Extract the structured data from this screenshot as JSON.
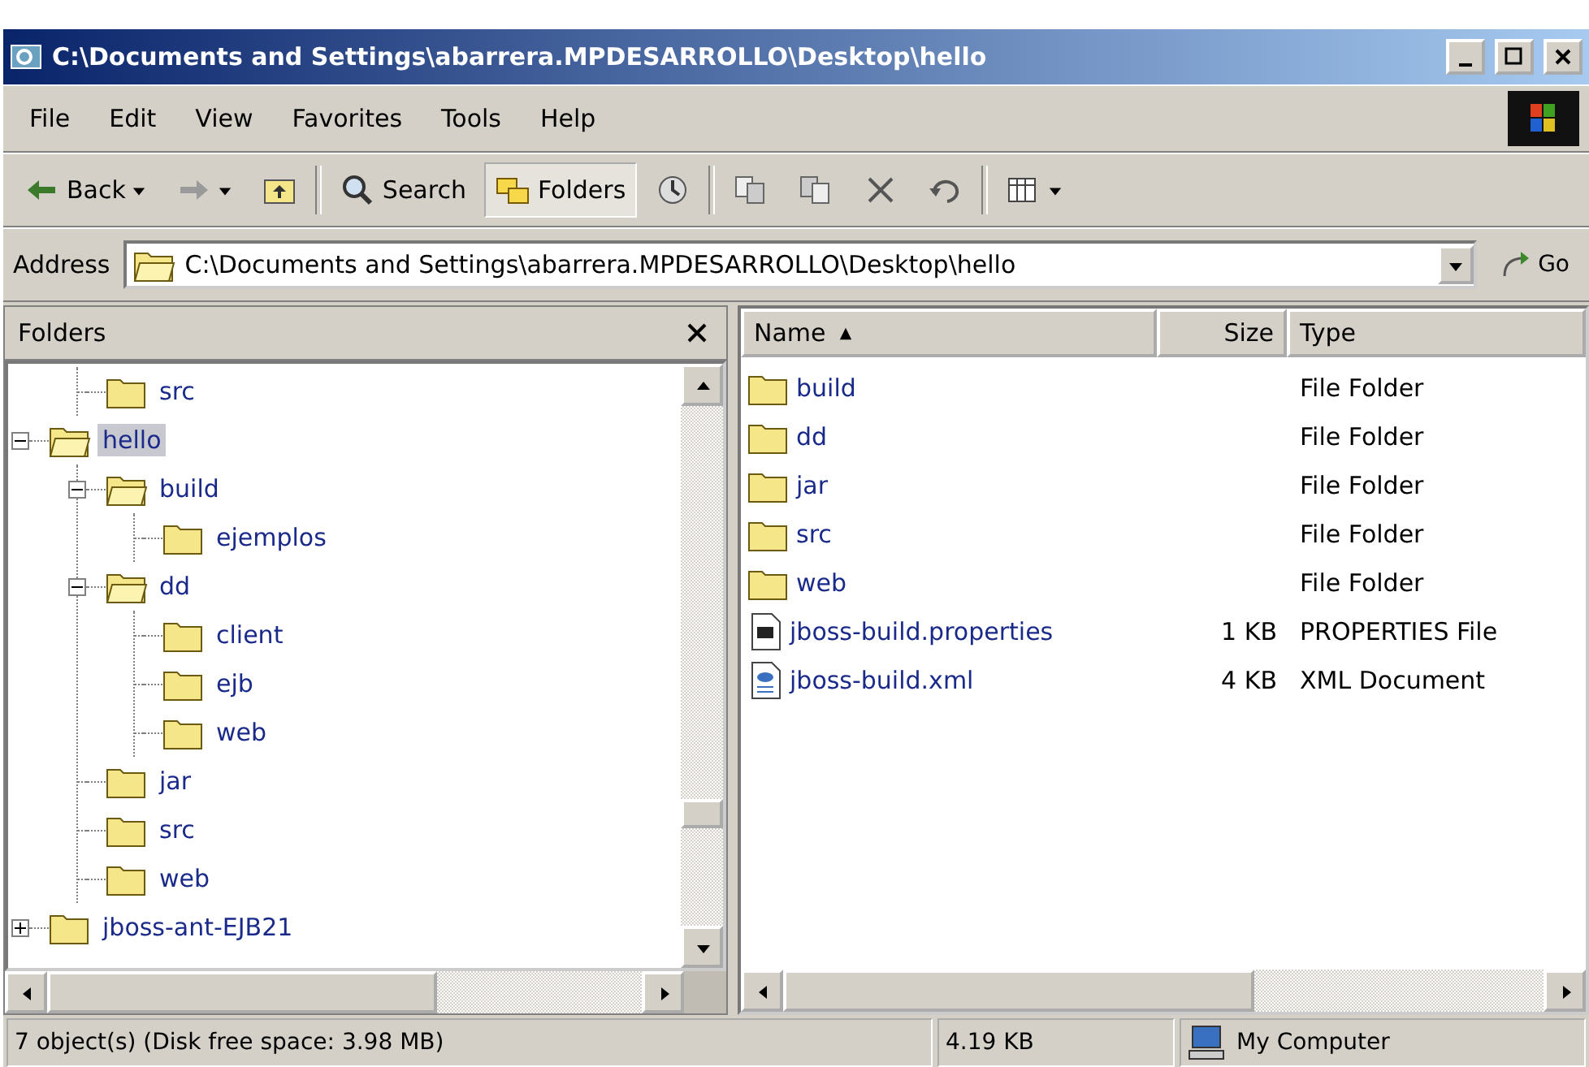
{
  "window": {
    "title": "C:\\Documents and Settings\\abarrera.MPDESARROLLO\\Desktop\\hello"
  },
  "menu": [
    "File",
    "Edit",
    "View",
    "Favorites",
    "Tools",
    "Help"
  ],
  "toolbar": [
    {
      "kind": "back",
      "label": "Back"
    },
    {
      "kind": "forward",
      "disabled": true
    },
    {
      "kind": "up"
    },
    {
      "kind": "sep"
    },
    {
      "kind": "search",
      "label": "Search",
      "selected": false
    },
    {
      "kind": "folders",
      "label": "Folders",
      "selected": true
    },
    {
      "kind": "history"
    },
    {
      "kind": "sep"
    },
    {
      "kind": "moveto"
    },
    {
      "kind": "copyto"
    },
    {
      "kind": "delete"
    },
    {
      "kind": "undo"
    },
    {
      "kind": "sep"
    },
    {
      "kind": "views"
    }
  ],
  "address": {
    "label": "Address",
    "value": "C:\\Documents and Settings\\abarrera.MPDESARROLLO\\Desktop\\hello",
    "go": "Go"
  },
  "folders_pane": {
    "title": "Folders",
    "scrolled_parent_children": [
      {
        "label": "src",
        "selected": false
      }
    ],
    "tree": [
      {
        "label": "hello",
        "selected": true,
        "expanded": true,
        "children": [
          {
            "label": "build",
            "selected": false,
            "expanded": true,
            "children": [
              {
                "label": "ejemplos",
                "selected": false
              }
            ]
          },
          {
            "label": "dd",
            "selected": false,
            "expanded": true,
            "children": [
              {
                "label": "client",
                "selected": false
              },
              {
                "label": "ejb",
                "selected": false
              },
              {
                "label": "web",
                "selected": false
              }
            ]
          },
          {
            "label": "jar",
            "selected": false
          },
          {
            "label": "src",
            "selected": false
          },
          {
            "label": "web",
            "selected": false
          }
        ]
      },
      {
        "label": "jboss-ant-EJB21",
        "selected": false,
        "expanded": false
      }
    ]
  },
  "file_list": {
    "columns": [
      {
        "label": "Name",
        "sorted": true
      },
      {
        "label": "Size",
        "sorted": false
      },
      {
        "label": "Type",
        "sorted": false
      }
    ],
    "rows": [
      {
        "kind": "folder",
        "name": "build",
        "type": "File Folder"
      },
      {
        "kind": "folder",
        "name": "dd",
        "type": "File Folder"
      },
      {
        "kind": "folder",
        "name": "jar",
        "type": "File Folder"
      },
      {
        "kind": "folder",
        "name": "src",
        "type": "File Folder"
      },
      {
        "kind": "folder",
        "name": "web",
        "type": "File Folder"
      },
      {
        "kind": "properties",
        "name": "jboss-build.properties",
        "size": "1 KB",
        "type": "PROPERTIES File"
      },
      {
        "kind": "xml",
        "name": "jboss-build.xml",
        "size": "4 KB",
        "type": "XML Document"
      }
    ]
  },
  "status_bar": {
    "objects": "7 object(s) (Disk free space: 3.98 MB)",
    "size": "4.19 KB",
    "zone": "My Computer"
  }
}
